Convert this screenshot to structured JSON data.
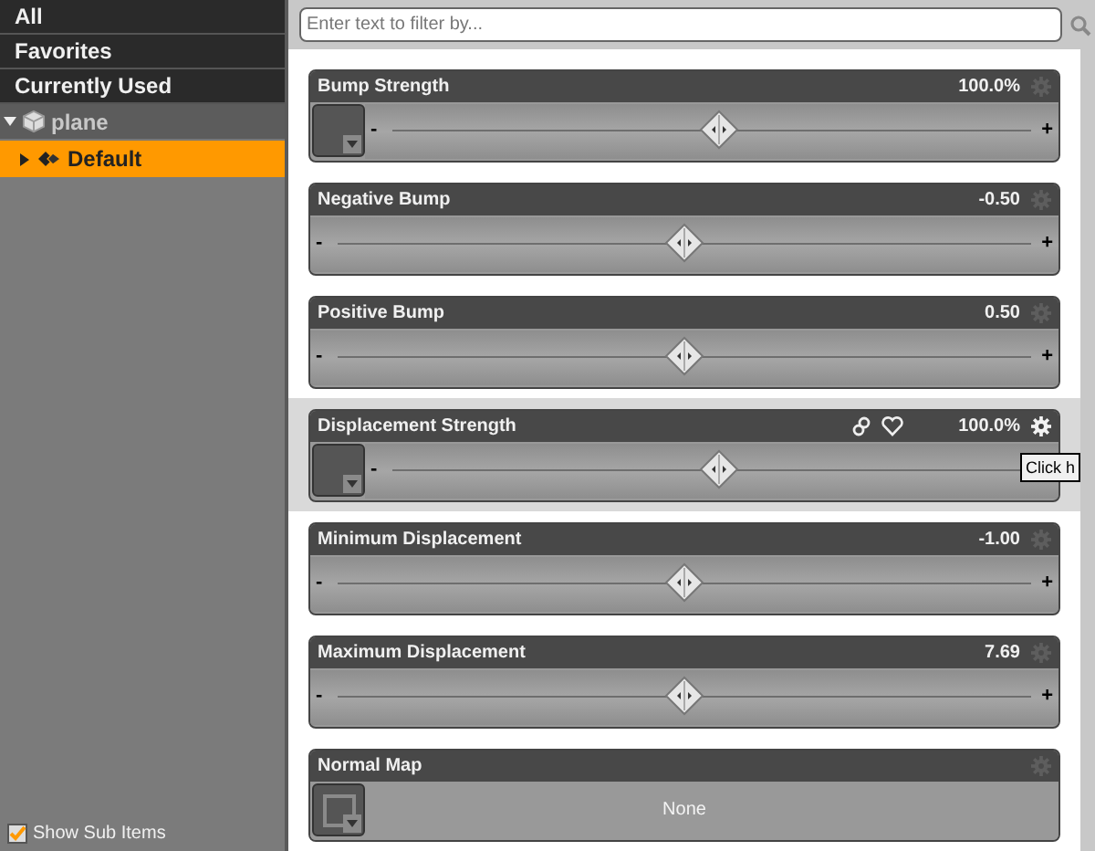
{
  "sidebar": {
    "categories": [
      {
        "label": "All",
        "selected": false
      },
      {
        "label": "Favorites",
        "selected": false
      },
      {
        "label": "Currently Used",
        "selected": false
      }
    ],
    "tree": [
      {
        "label": "plane",
        "kind": "object",
        "expanded": true,
        "selected": false,
        "children": [
          {
            "label": "Default",
            "kind": "material",
            "expanded": false,
            "selected": true
          }
        ]
      }
    ],
    "show_sub_items": {
      "label": "Show Sub Items",
      "checked": true
    }
  },
  "filter": {
    "placeholder": "Enter text to filter by..."
  },
  "properties": [
    {
      "kind": "slider",
      "label": "Bump Strength",
      "value": "100.0%",
      "has_map": true,
      "level": 0.51,
      "selected": false
    },
    {
      "kind": "slider",
      "label": "Negative Bump",
      "value": "-0.50",
      "has_map": false,
      "level": 0.5,
      "selected": false
    },
    {
      "kind": "slider",
      "label": "Positive Bump",
      "value": "0.50",
      "has_map": false,
      "level": 0.5,
      "selected": false
    },
    {
      "kind": "slider",
      "label": "Displacement Strength",
      "value": "100.0%",
      "has_map": true,
      "level": 0.51,
      "selected": true,
      "tooltip": "Click h"
    },
    {
      "kind": "slider",
      "label": "Minimum Displacement",
      "value": "-1.00",
      "has_map": false,
      "level": 0.5,
      "selected": false
    },
    {
      "kind": "slider",
      "label": "Maximum Displacement",
      "value": "7.69",
      "has_map": false,
      "level": 0.5,
      "selected": false
    },
    {
      "kind": "map",
      "label": "Normal Map",
      "value": "None",
      "selected": false
    }
  ],
  "slider_ends": {
    "minus": "-",
    "plus": "+"
  }
}
